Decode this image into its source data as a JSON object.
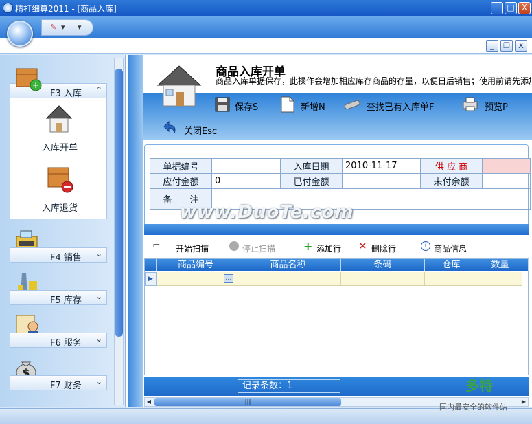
{
  "window": {
    "title": "精打细算2011 - [商品入库]",
    "min": "_",
    "max": "□",
    "close": "X"
  },
  "mdi": {
    "min": "_",
    "restore": "❐",
    "close": "X"
  },
  "qat": {
    "arrow": "▾",
    "more": "▾"
  },
  "nav": {
    "sections": [
      {
        "label": "F3 入库",
        "chev": "⌃"
      },
      {
        "label": "F4 销售",
        "chev": "⌄"
      },
      {
        "label": "F5 库存",
        "chev": "⌄"
      },
      {
        "label": "F6 服务",
        "chev": "⌄"
      },
      {
        "label": "F7 财务",
        "chev": "⌄"
      }
    ],
    "subitems": [
      "入库开单",
      "入库退货"
    ]
  },
  "page": {
    "title": "商品入库开单",
    "description": "商品入库单据保存，此操作会增加相应库存商品的存量，以便日后销售；使用前请先添加价"
  },
  "toolbar": {
    "save": "保存S",
    "new": "新增N",
    "find": "查找已有入库单F",
    "preview": "预览P",
    "close": "关闭Esc"
  },
  "form": {
    "doc_no_label": "单据编号",
    "doc_no_value": "",
    "date_label": "入库日期",
    "date_value": "2010-11-17",
    "supplier_label": "供 应 商",
    "supplier_value": "",
    "payable_label": "应付金额",
    "payable_value": "0",
    "paid_label": "已付金额",
    "paid_value": "",
    "unpaid_label": "未付余额",
    "unpaid_value": "",
    "remark_label": "备　　注",
    "remark_value": ""
  },
  "subtoolbar": {
    "start_scan": "开始扫描",
    "stop_scan": "停止扫描",
    "add_row": "添加行",
    "del_row": "删除行",
    "product_info": "商品信息"
  },
  "grid": {
    "columns": [
      "商品编号",
      "商品名称",
      "条码",
      "仓库",
      "数量"
    ],
    "row_indicator": "▶",
    "ellipsis": "…"
  },
  "footer": {
    "record_count": "记录条数：1",
    "hscroll_grip": "|||"
  },
  "watermarks": {
    "center": "www.DuoTe.com",
    "corner": "多特",
    "corner_sub": "国内最安全的软件站"
  },
  "colors": {
    "accent": "#1f6acb",
    "required": "#d00000",
    "supplier_bg": "#f9d4d4"
  }
}
